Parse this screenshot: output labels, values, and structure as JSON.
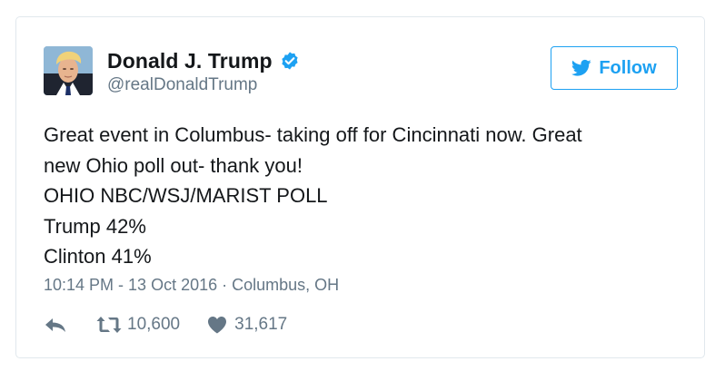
{
  "author": {
    "display_name": "Donald J. Trump",
    "handle": "@realDonaldTrump",
    "verified_icon": "verified-badge-icon"
  },
  "follow_button": {
    "label": "Follow",
    "icon": "twitter-bird-icon"
  },
  "tweet": {
    "lines": [
      "Great event in Columbus- taking off for Cincinnati now. Great",
      "new Ohio poll out- thank you!",
      "OHIO NBC/WSJ/MARIST POLL",
      "Trump 42%",
      "Clinton 41%"
    ],
    "meta": "10:14 PM - 13 Oct 2016 · Columbus, OH"
  },
  "actions": {
    "reply_icon": "reply-icon",
    "retweet_icon": "retweet-icon",
    "retweet_count": "10,600",
    "like_icon": "heart-icon",
    "like_count": "31,617"
  },
  "colors": {
    "accent": "#1da1f2",
    "text": "#14171a",
    "muted": "#657786",
    "border": "#e1e8ed"
  }
}
